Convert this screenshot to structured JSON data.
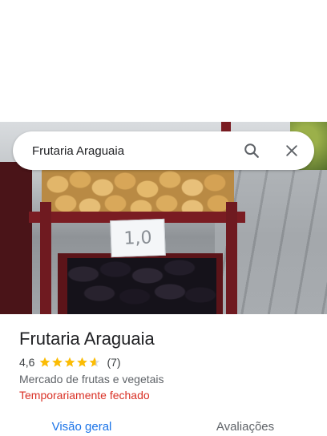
{
  "search": {
    "value": "Frutaria Araguaia",
    "search_icon": "search-icon",
    "close_icon": "close-icon"
  },
  "hero_photo": {
    "sign_text": "1,0"
  },
  "place": {
    "title": "Frutaria Araguaia",
    "rating": "4,6",
    "stars": 4.6,
    "review_count": "(7)",
    "category": "Mercado de frutas e vegetais",
    "status": "Temporariamente fechado"
  },
  "tabs": [
    {
      "label": "Visão geral",
      "active": true
    },
    {
      "label": "Avaliações",
      "active": false
    }
  ],
  "colors": {
    "accent": "#1a73e8",
    "star": "#fbbc04",
    "closed": "#d93025"
  }
}
